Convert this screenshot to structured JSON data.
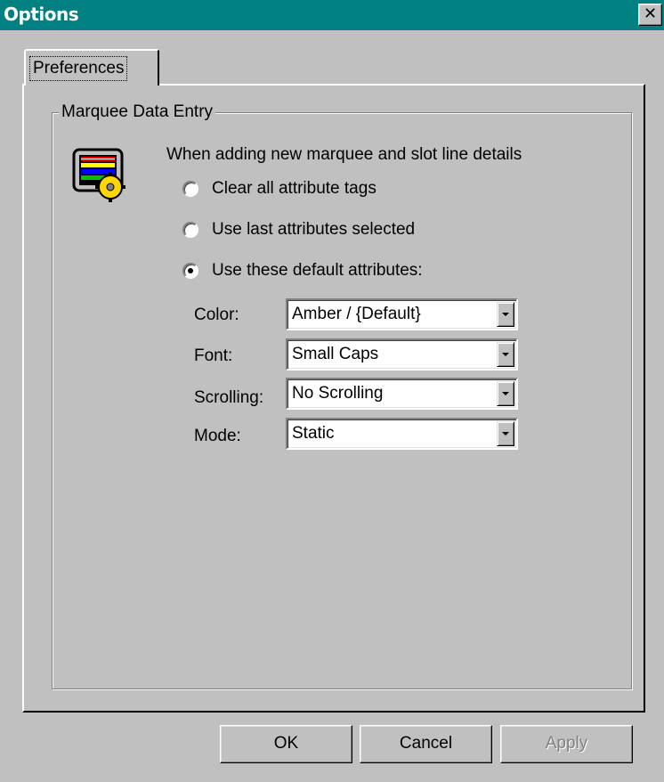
{
  "window": {
    "title": "Options",
    "close_glyph": "✕"
  },
  "tabs": [
    {
      "label": "Preferences",
      "selected": true
    }
  ],
  "group": {
    "title": "Marquee Data Entry",
    "icon": "marquee-settings-icon",
    "prompt": "When adding new marquee and slot line details",
    "options": [
      {
        "label": "Clear all attribute tags",
        "selected": false
      },
      {
        "label": "Use last attributes selected",
        "selected": false
      },
      {
        "label": "Use these default attributes:",
        "selected": true
      }
    ],
    "fields": [
      {
        "label": "Color:",
        "value": "Amber / {Default}"
      },
      {
        "label": "Font:",
        "value": "Small Caps"
      },
      {
        "label": "Scrolling:",
        "value": "No Scrolling"
      },
      {
        "label": "Mode:",
        "value": "Static"
      }
    ]
  },
  "buttons": {
    "ok": "OK",
    "cancel": "Cancel",
    "apply": "Apply",
    "apply_enabled": false
  },
  "colors": {
    "titlebar": "#008080",
    "face": "#c0c0c0"
  }
}
